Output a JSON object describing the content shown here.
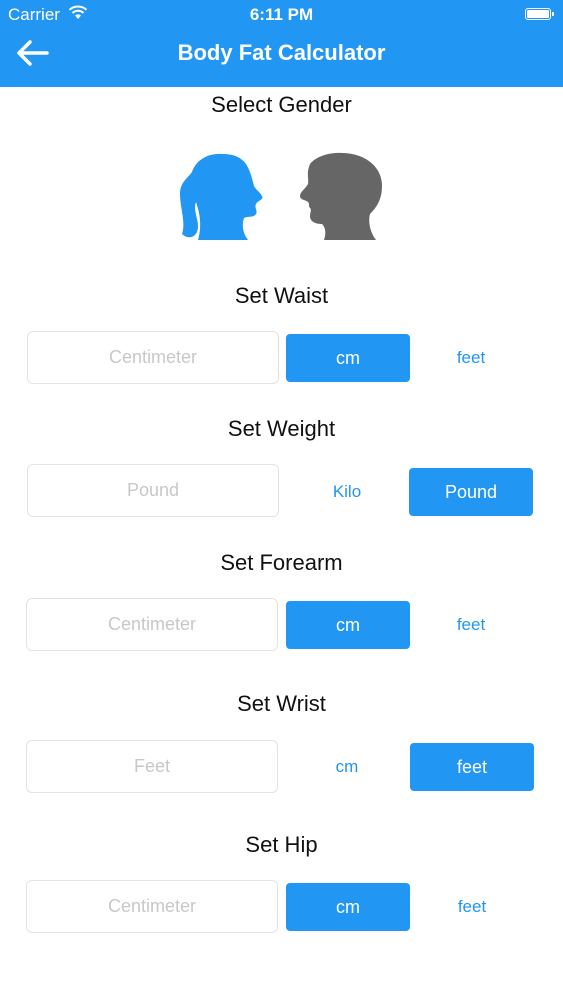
{
  "status_bar": {
    "carrier": "Carrier",
    "time": "6:11 PM"
  },
  "nav": {
    "title": "Body Fat Calculator"
  },
  "gender": {
    "title": "Select Gender"
  },
  "waist": {
    "title": "Set Waist",
    "placeholder": "Centimeter",
    "unit_a": "cm",
    "unit_b": "feet"
  },
  "weight": {
    "title": "Set Weight",
    "placeholder": "Pound",
    "unit_a": "Kilo",
    "unit_b": "Pound"
  },
  "forearm": {
    "title": "Set Forearm",
    "placeholder": "Centimeter",
    "unit_a": "cm",
    "unit_b": "feet"
  },
  "wrist": {
    "title": "Set Wrist",
    "placeholder": "Feet",
    "unit_a": "cm",
    "unit_b": "feet"
  },
  "hip": {
    "title": "Set Hip",
    "placeholder": "Centimeter",
    "unit_a": "cm",
    "unit_b": "feet"
  },
  "colors": {
    "accent": "#2196f3",
    "male_icon": "#666666"
  }
}
